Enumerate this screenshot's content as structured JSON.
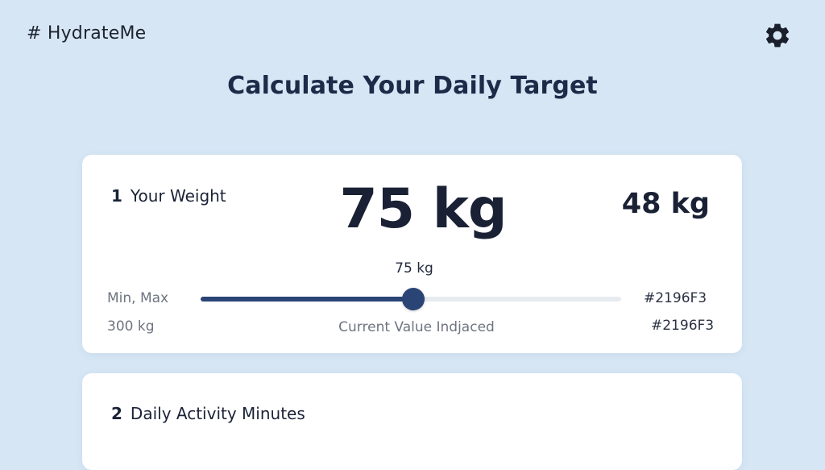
{
  "app": {
    "name": "# HydrateMe",
    "settings_icon": "gear-icon"
  },
  "page": {
    "title": "Calculate Your Daily Target"
  },
  "weight_card": {
    "step_number": "1",
    "step_label": "Your Weight",
    "current_display": "75 kg",
    "side_value": "48 kg",
    "slider": {
      "value_label": "75 kg",
      "value": 75,
      "min": 0,
      "max": 300,
      "minmax_label": "Min, Max",
      "max_value_label": "300 kg",
      "caption": "Current Value Indjaced",
      "color_label_1": "#2196F3",
      "color_label_2": "#2196F3",
      "fill_color": "#2b4476"
    }
  },
  "activity_card": {
    "step_number": "2",
    "step_label": "Daily Activity Minutes"
  }
}
